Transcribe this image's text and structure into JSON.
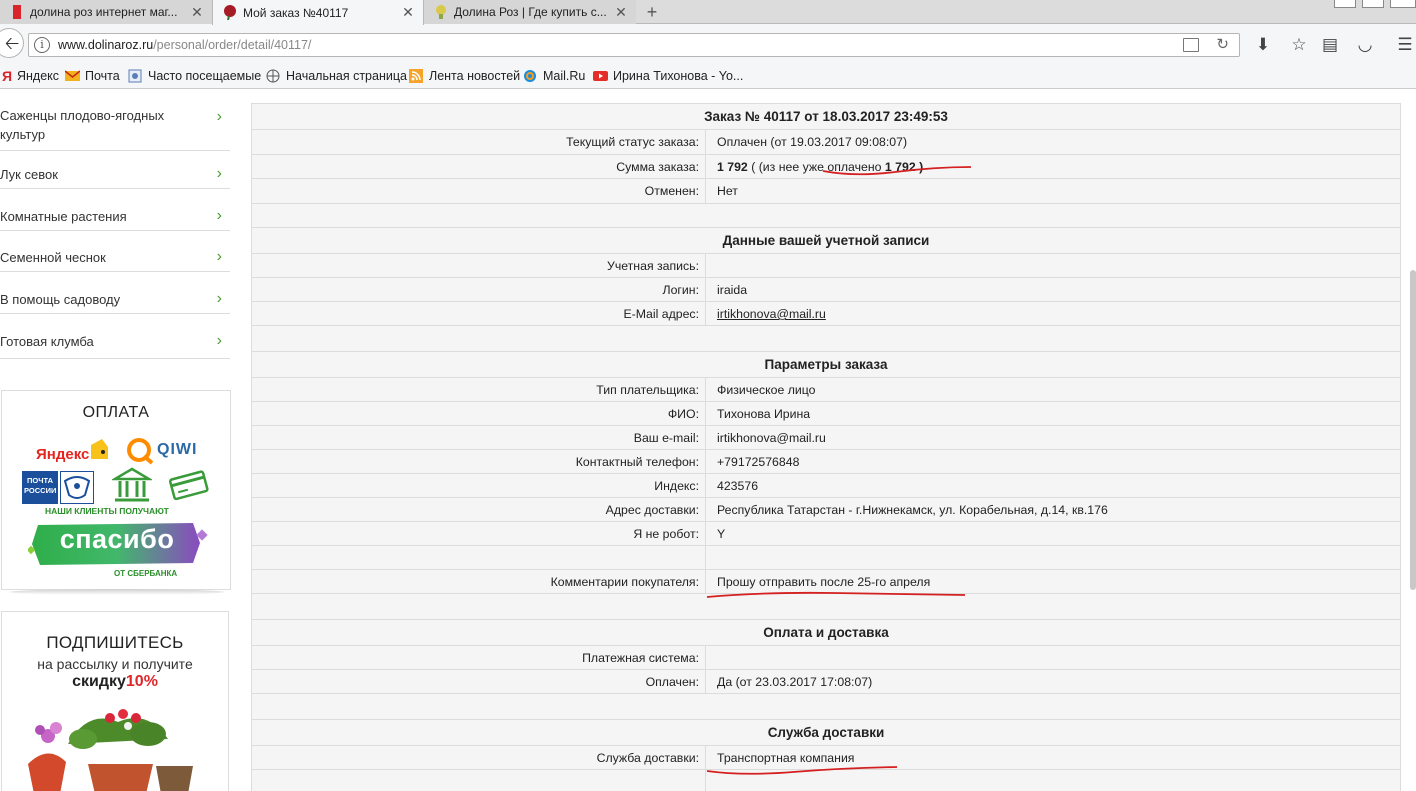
{
  "browser": {
    "tabs": [
      {
        "title": "долина роз интернет маг...",
        "active": false
      },
      {
        "title": "Мой заказ №40117",
        "active": true
      },
      {
        "title": "Долина Роз | Где купить с...",
        "active": false
      }
    ],
    "url_domain": "www.dolinaroz.ru",
    "url_path": "/personal/order/detail/40117/",
    "bookmarks": [
      {
        "label": "Яндекс",
        "icon": "yandex-icon"
      },
      {
        "label": "Почта",
        "icon": "mail-envelope-icon"
      },
      {
        "label": "Часто посещаемые",
        "icon": "frequent-icon"
      },
      {
        "label": "Начальная страница",
        "icon": "globe-icon"
      },
      {
        "label": "Лента новостей",
        "icon": "rss-icon"
      },
      {
        "label": "Mail.Ru",
        "icon": "mailru-icon"
      },
      {
        "label": "Ирина Тихонова - Yo...",
        "icon": "youtube-icon"
      }
    ]
  },
  "sidebar": {
    "categories": [
      "Саженцы плодово-ягодных культур",
      "Лук севок",
      "Комнатные растения",
      "Семенной чеснок",
      "В помощь садоводу",
      "Готовая клумба"
    ],
    "payment": {
      "title": "ОПЛАТА",
      "yandex": "Яндекс",
      "qiwi": "QIWI",
      "pochta": "ПОЧТА РОССИИ",
      "spasibo_top": "НАШИ КЛИЕНТЫ ПОЛУЧАЮТ",
      "spasibo": "спасибо",
      "spasibo_bottom": "ОТ СБЕРБАНКА"
    },
    "subscribe": {
      "title": "ПОДПИШИТЕСЬ",
      "line2": "на рассылку и получите",
      "discount_word": "скидку",
      "discount_value": "10%"
    }
  },
  "order": {
    "title": "Заказ № 40117 от 18.03.2017 23:49:53",
    "status_label": "Текущий статус заказа:",
    "status_value": "Оплачен (от 19.03.2017 09:08:07)",
    "sum_label": "Сумма заказа:",
    "sum_amount": "1 792",
    "sum_paid_prefix": " ( (из нее уже оплачено ",
    "sum_paid_amount": "1 792 )",
    "canceled_label": "Отменен:",
    "canceled_value": "Нет",
    "account_title": "Данные вашей учетной записи",
    "account_label": "Учетная запись:",
    "account_value": "",
    "login_label": "Логин:",
    "login_value": "iraida",
    "email_label": "E-Mail адрес:",
    "email_value": "irtikhonova@mail.ru",
    "params_title": "Параметры заказа",
    "payer_type_label": "Тип плательщика:",
    "payer_type_value": "Физическое лицо",
    "fio_label": "ФИО:",
    "fio_value": "Тихонова Ирина",
    "your_email_label": "Ваш e-mail:",
    "your_email_value": "irtikhonova@mail.ru",
    "phone_label": "Контактный телефон:",
    "phone_value": "+79172576848",
    "index_label": "Индекс:",
    "index_value": "423576",
    "address_label": "Адрес доставки:",
    "address_value": "Республика Татарстан - г.Нижнекамск, ул. Корабельная, д.14, кв.176",
    "robot_label": "Я не робот:",
    "robot_value": "Y",
    "comment_label": "Комментарии покупателя:",
    "comment_value": "Прошу отправить после 25-го апреля",
    "payment_title": "Оплата и доставка",
    "pay_system_label": "Платежная система:",
    "pay_system_value": "",
    "paid_label": "Оплачен:",
    "paid_value": "Да (от 23.03.2017 17:08:07)",
    "delivery_title": "Служба доставки",
    "delivery_label": "Служба доставки:",
    "delivery_value": "Транспортная компания"
  },
  "colors": {
    "annotation_red": "#d42020",
    "arrow_green": "#4a9c2f",
    "discount_red": "#e0262b"
  }
}
